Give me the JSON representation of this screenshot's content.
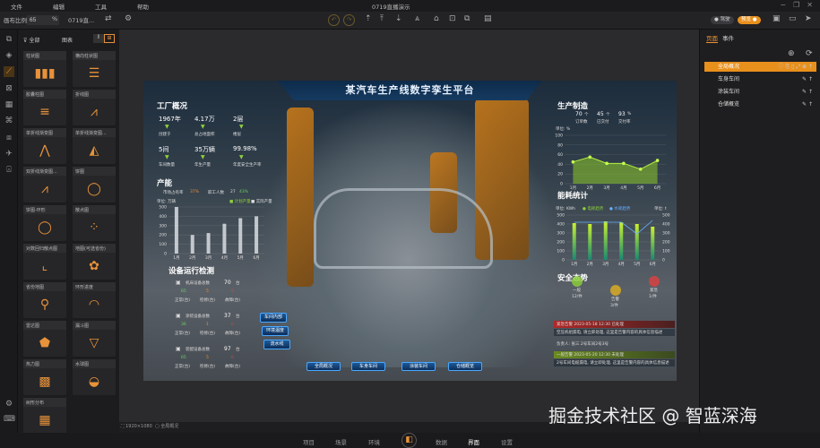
{
  "menu": [
    "文件",
    "编辑",
    "工具",
    "帮助"
  ],
  "window_title": "0719直播演示",
  "toolbar": {
    "scale_label": "画布比例",
    "scale_value": "65",
    "scale_unit": "%",
    "project_name": "0719直...",
    "toggle_left": "驾驶",
    "toggle_right": "预览"
  },
  "components": {
    "filter": "全部",
    "category": "图表",
    "items": [
      "柱状图",
      "横向柱状图",
      "胶囊柱图",
      "折线图",
      "单折线渐变图",
      "单折线渐变图...",
      "双折线渐变图...",
      "饼图",
      "饼图-环形",
      "散点图",
      "对数回归散点图",
      "地图(可选省份)",
      "省份地图",
      "环形进度",
      "雷达图",
      "漏斗图",
      "热力图",
      "水球图",
      "树形分布"
    ]
  },
  "dashboard": {
    "title": "某汽车生产线数字孪生平台",
    "factory": {
      "title": "工厂概况",
      "stats": [
        {
          "value": "1967年",
          "label": "创建于"
        },
        {
          "value": "4.17万",
          "label": "总占地面积"
        },
        {
          "value": "2层",
          "label": "楼层"
        },
        {
          "value": "5间",
          "label": "车间数量"
        },
        {
          "value": "35万辆",
          "label": "年生产量"
        },
        {
          "value": "99.98%",
          "label": "年度安全生产率"
        }
      ]
    },
    "capacity": {
      "title": "产能",
      "market_label": "市场占有率",
      "market_value": "37%",
      "staff_label": "职工人数",
      "staff_value": "27",
      "staff_extra": "43%",
      "unit": "单位: 万辆",
      "legend": [
        "计划产量",
        "实际产量"
      ]
    },
    "equipment": {
      "title": "设备运行检测",
      "groups": [
        {
          "name": "机床设备总数",
          "total": "70",
          "unit": "台",
          "normal": "65",
          "repair": "5",
          "fault": "0"
        },
        {
          "name": "涂装设备总数",
          "total": "37",
          "unit": "台",
          "normal": "36",
          "repair": "1",
          "fault": "0"
        },
        {
          "name": "装配设备总数",
          "total": "97",
          "unit": "台",
          "normal": "65",
          "repair": "5",
          "fault": "0"
        }
      ],
      "labels": [
        "正常(台)",
        "检修(台)",
        "故障(台)"
      ]
    },
    "side_buttons": [
      "车间内部",
      "环境温度",
      "流水线"
    ],
    "production": {
      "title": "生产制造",
      "kpis": [
        {
          "value": "70",
          "unit": "个",
          "label": "订单数"
        },
        {
          "value": "45",
          "unit": "个",
          "label": "已交付"
        },
        {
          "value": "93",
          "unit": "%",
          "label": "交付率"
        }
      ],
      "unit": "单位: %"
    },
    "energy": {
      "title": "能耗统计",
      "unit_left": "单位: KWh",
      "unit_right": "单位: t",
      "legend": [
        "电耗趋势",
        "水耗趋势"
      ]
    },
    "safety": {
      "title": "安全态势",
      "levels": [
        {
          "name": "一般",
          "count": "12/件",
          "color": "#8fd13a"
        },
        {
          "name": "告警",
          "count": "3/件",
          "color": "#e0b020"
        },
        {
          "name": "紧急",
          "count": "1/件",
          "color": "#e04040"
        }
      ],
      "alarms": [
        {
          "head": "紧急告警  2023-05-18 12:30 已处理",
          "body": "空压机组漏电, 请立即处理, 这里是告警内容的具体信息描述",
          "extra": "负责人: 张三  2号车间2号3号"
        },
        {
          "head": "一般告警  2023-05-20 12:30 未处理",
          "body": "2号车间电缆漏电, 请立即处理, 这里是告警内容的具体信息描述"
        }
      ]
    },
    "nav": [
      "全局概况",
      "车身车间",
      "涂装车间",
      "仓储概览"
    ]
  },
  "status": {
    "resolution": "1920×1080",
    "page": "全局概况"
  },
  "right_panel": {
    "tabs": [
      "页面",
      "事件"
    ],
    "pages": [
      "全局概况",
      "车身车间",
      "涂装车间",
      "仓储概览"
    ]
  },
  "bottom_nav": [
    "项目",
    "场景",
    "环境",
    "数据",
    "界面",
    "设置"
  ],
  "watermark": "掘金技术社区 @ 智蓝深海",
  "chart_data": [
    {
      "type": "bar",
      "title": "产能",
      "categories": [
        "1月",
        "2月",
        "3月",
        "4月",
        "5月",
        "6月"
      ],
      "values": [
        500,
        200,
        220,
        320,
        380,
        400
      ],
      "ylim": [
        0,
        500
      ],
      "yticks": [
        0,
        100,
        200,
        300,
        400,
        500
      ],
      "ylabel": "单位: 万辆"
    },
    {
      "type": "area",
      "title": "生产制造",
      "categories": [
        "1月",
        "2月",
        "3月",
        "4月",
        "5月",
        "6月"
      ],
      "values": [
        45,
        55,
        42,
        42,
        30,
        48
      ],
      "ylim": [
        0,
        100
      ],
      "yticks": [
        0,
        20,
        40,
        60,
        80,
        100
      ],
      "ylabel": "单位: %"
    },
    {
      "type": "bar",
      "title": "能耗统计",
      "categories": [
        "1月",
        "2月",
        "3月",
        "4月",
        "5月",
        "6月"
      ],
      "series": [
        {
          "name": "电耗趋势",
          "type": "bar",
          "values": [
            410,
            400,
            430,
            420,
            400,
            370
          ]
        },
        {
          "name": "水耗趋势",
          "type": "line",
          "values": [
            420,
            420,
            420,
            420,
            290,
            440
          ]
        }
      ],
      "ylim": [
        0,
        500
      ],
      "yticks": [
        0,
        100,
        200,
        300,
        400,
        500
      ]
    }
  ],
  "colors": {
    "accent": "#e8923a",
    "selected": "#e8901c",
    "dash_bg": "#1c2c3c"
  }
}
